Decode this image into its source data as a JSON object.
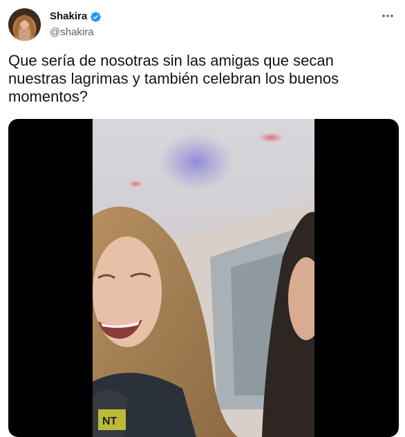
{
  "author": {
    "display_name": "Shakira",
    "handle": "@shakira",
    "verified": true,
    "avatar_icon": "profile-photo"
  },
  "tweet": {
    "text": "Que sería de nosotras sin las amigas que secan\nnuestras lagrimas y también celebran los buenos\nmomentos?"
  },
  "media": {
    "type": "video",
    "shirt_print": "NT"
  },
  "icons": {
    "verified": "verified-badge-icon",
    "more": "more-options-icon"
  },
  "colors": {
    "verified_blue": "#1d9bf0",
    "secondary_text": "#536471",
    "media_background": "#000000"
  }
}
